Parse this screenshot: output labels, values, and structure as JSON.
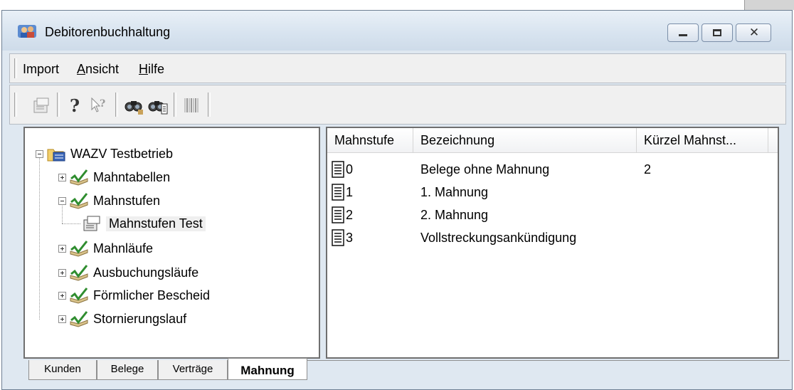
{
  "window": {
    "title": "Debitorenbuchhaltung"
  },
  "menu": [
    {
      "label": "Import",
      "underline": ""
    },
    {
      "label": "Ansicht",
      "underline": "A"
    },
    {
      "label": "Hilfe",
      "underline": "H"
    }
  ],
  "toolbar": {
    "icons": [
      "properties-icon",
      "help-icon",
      "context-help-icon",
      "find-icon",
      "find-next-icon",
      "barcode-icon"
    ]
  },
  "tree": {
    "root": "WAZV Testbetrieb",
    "items": [
      {
        "label": "Mahntabellen",
        "expanded": false
      },
      {
        "label": "Mahnstufen",
        "expanded": true,
        "children": [
          {
            "label": "Mahnstufen Test",
            "selected": true
          }
        ]
      },
      {
        "label": "Mahnläufe",
        "expanded": false
      },
      {
        "label": "Ausbuchungsläufe",
        "expanded": false
      },
      {
        "label": "Förmlicher Bescheid",
        "expanded": false
      },
      {
        "label": "Stornierungslauf",
        "expanded": false
      }
    ]
  },
  "list": {
    "columns": [
      "Mahnstufe",
      "Bezeichnung",
      "Kürzel Mahnst..."
    ],
    "rows": [
      {
        "mahnstufe": "0",
        "bezeichnung": "Belege ohne Mahnung",
        "kuerzel": "2"
      },
      {
        "mahnstufe": "1",
        "bezeichnung": "1. Mahnung",
        "kuerzel": ""
      },
      {
        "mahnstufe": "2",
        "bezeichnung": "2. Mahnung",
        "kuerzel": ""
      },
      {
        "mahnstufe": "3",
        "bezeichnung": "Vollstreckungsankündigung",
        "kuerzel": ""
      }
    ]
  },
  "tabs": [
    {
      "label": "Kunden",
      "active": false
    },
    {
      "label": "Belege",
      "active": false
    },
    {
      "label": "Verträge",
      "active": false
    },
    {
      "label": "Mahnung",
      "active": true
    }
  ]
}
